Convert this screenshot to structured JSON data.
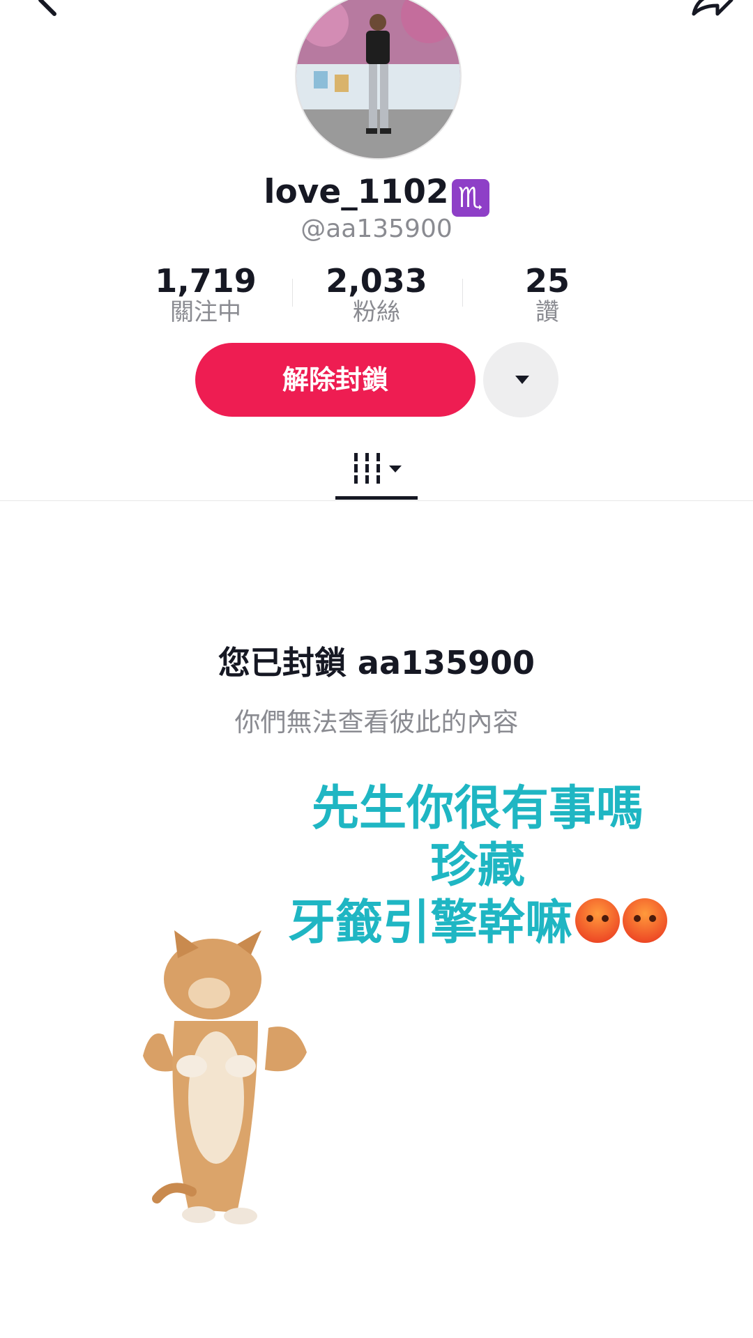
{
  "profile": {
    "display_name": "love_1102",
    "zodiac_badge": "♏",
    "handle": "@aa135900"
  },
  "stats": [
    {
      "value": "1,719",
      "label": "關注中"
    },
    {
      "value": "2,033",
      "label": "粉絲"
    },
    {
      "value": "25",
      "label": "讚"
    }
  ],
  "actions": {
    "unblock_label": "解除封鎖"
  },
  "blocked": {
    "title": "您已封鎖 aa135900",
    "subtitle": "你們無法查看彼此的內容"
  },
  "overlay": {
    "line1": "先生你很有事嗎",
    "line2": "珍藏",
    "line3": "牙籤引擎幹嘛"
  },
  "colors": {
    "accent": "#ee1d52",
    "overlay_text": "#1fb6c3"
  },
  "icons": [
    "back-arrow-icon",
    "share-icon",
    "dropdown-triangle-icon",
    "videos-grid-icon",
    "angry-face-emoji"
  ]
}
